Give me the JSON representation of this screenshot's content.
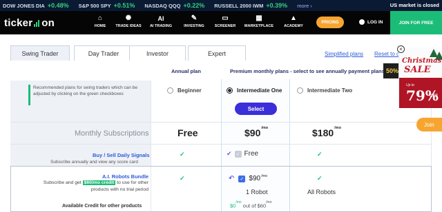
{
  "ticker": {
    "items": [
      {
        "name": "DOW JONES DIA",
        "change": "+0.48%"
      },
      {
        "name": "S&P 500 SPY",
        "change": "+0.51%"
      },
      {
        "name": "NASDAQ QQQ",
        "change": "+0.22%"
      },
      {
        "name": "RUSSELL 2000 IWM",
        "change": "+0.39%"
      }
    ],
    "more": "more ›",
    "market_status": "US market is closed"
  },
  "nav": {
    "logo_left": "ticker",
    "logo_right": "on",
    "items": [
      {
        "label": "HOME",
        "icon": "home-icon"
      },
      {
        "label": "TRADE IDEAS",
        "icon": "lightbulb-icon"
      },
      {
        "label": "AI TRADING",
        "icon": "ai-icon"
      },
      {
        "label": "INVESTING",
        "icon": "wrench-icon"
      },
      {
        "label": "SCREENER",
        "icon": "monitor-icon"
      },
      {
        "label": "MARKETPLACE",
        "icon": "store-icon"
      },
      {
        "label": "ACADEMY",
        "icon": "graduation-cap-icon"
      }
    ],
    "pricing": "PRICING",
    "login": "LOG IN",
    "join": "JOIN FOR FREE"
  },
  "tabs": [
    "Swing Trader",
    "Day Trader",
    "Investor",
    "Expert"
  ],
  "links": {
    "simplified": "Simplified plans",
    "reset": "Reset to d"
  },
  "headers": {
    "annual": "Annual plan",
    "premium": "Premium monthly plans - select to see annually payment plans",
    "badge": "50%"
  },
  "recommend_text": "Recommended plans for swing traders which can be adjusted by clicking on the green checkboxes",
  "plans": {
    "beginner": "Beginner",
    "intermediate_one": "Intermediate One",
    "intermediate_two": "Intermediate Two",
    "select": "Select"
  },
  "monthly": {
    "label": "Monthly Subscriptions",
    "free": "Free",
    "price_one": "$90",
    "price_two": "$180",
    "unit": "/mo"
  },
  "signals": {
    "title": "Buy / Sell Daily Signals",
    "desc": "Subscribe annually and view any score card",
    "free_label": "Free"
  },
  "robots": {
    "title": "A.I. Robots Bundle",
    "desc_prefix": "Subscribe and get",
    "credit": "$60/mo credit",
    "desc_suffix": "to use for other products with no trial period",
    "price": "$90",
    "unit": "/mo",
    "one": "1 Robot",
    "all": "All Robots",
    "credit_used": "$0",
    "credit_mid": "out of $60",
    "credit_unit": "/mo"
  },
  "available_credit": "Available Credit for other products",
  "ad": {
    "line1": "Christmas",
    "line2": "SALE",
    "upto": "Up to",
    "percent": "79%",
    "off": "OFF"
  },
  "join_side": "Join"
}
